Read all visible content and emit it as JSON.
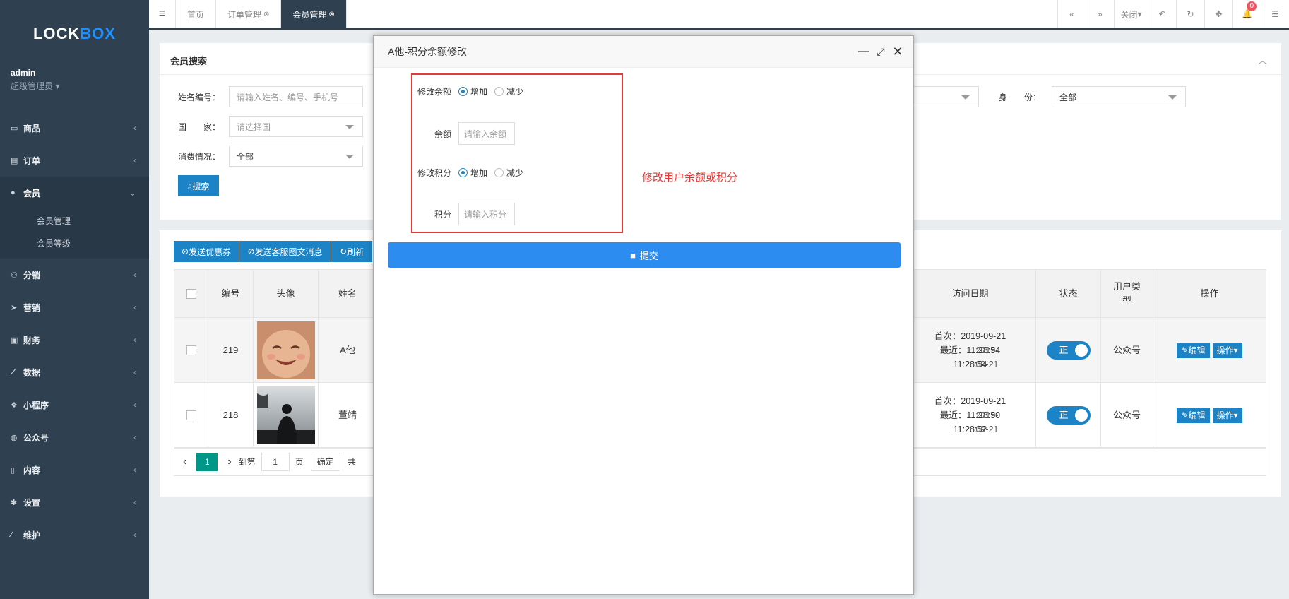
{
  "sidebar": {
    "logo": "LOCK",
    "logo_accent": "BOX",
    "user_name": "admin",
    "user_role": "超级管理员",
    "items": [
      {
        "label": "商品",
        "icon": "laptop-icon"
      },
      {
        "label": "订单",
        "icon": "file-icon"
      },
      {
        "label": "会员",
        "icon": "user-icon",
        "active": true,
        "children": [
          "会员管理",
          "会员等级"
        ]
      },
      {
        "label": "分销",
        "icon": "users-icon"
      },
      {
        "label": "营销",
        "icon": "paper-plane-icon"
      },
      {
        "label": "财务",
        "icon": "money-icon"
      },
      {
        "label": "数据",
        "icon": "line-chart-icon"
      },
      {
        "label": "小程序",
        "icon": "cubes-icon"
      },
      {
        "label": "公众号",
        "icon": "wechat-icon"
      },
      {
        "label": "内容",
        "icon": "book-icon"
      },
      {
        "label": "设置",
        "icon": "gear-icon"
      },
      {
        "label": "维护",
        "icon": "wand-icon"
      }
    ]
  },
  "topbar": {
    "tabs": [
      {
        "label": "首页"
      },
      {
        "label": "订单管理"
      },
      {
        "label": "会员管理",
        "active": true
      }
    ],
    "close_label": "关闭",
    "notif_count": "0"
  },
  "search": {
    "title": "会员搜索",
    "name_label": "姓名编号：",
    "name_placeholder": "请输入姓名、编号、手机号",
    "country_label": "国　　家：",
    "country_value": "请选择国",
    "consume_label": "消费情况：",
    "consume_value": "全部",
    "identity_label": "身　　份：",
    "identity_value": "全部",
    "search_btn": "搜索"
  },
  "toolbar": {
    "coupon_btn": "发送优惠券",
    "message_btn": "发送客服图文消息",
    "refresh_btn": "刷新"
  },
  "table": {
    "headers": {
      "id": "编号",
      "avatar": "头像",
      "name": "姓名",
      "visit": "访问日期",
      "status": "状态",
      "user_type": "用户类型",
      "ops": "操作"
    },
    "rows": [
      {
        "id": "219",
        "name": "A他",
        "visit_first": "首次：2019-09-21",
        "visit_last_a": "最近：",
        "visit_last_b": "11:28:54",
        "visit_overlay": "2019-09-21",
        "time": "11:28:54",
        "status": "正",
        "user_type": "公众号"
      },
      {
        "id": "218",
        "name": "董靖",
        "visit_first": "首次：2019-09-21",
        "visit_last_a": "最近：",
        "visit_last_b": "11:28:50",
        "visit_overlay": "2019-09-21",
        "time": "11:28:52",
        "status": "正",
        "user_type": "公众号"
      }
    ],
    "edit_btn": "编辑",
    "action_btn": "操作"
  },
  "pager": {
    "current": "1",
    "goto_label": "到第",
    "page_input": "1",
    "page_unit": "页",
    "confirm": "确定",
    "total_prefix": "共"
  },
  "modal": {
    "title": "A他-积分余额修改",
    "balance_mode_label": "修改余额",
    "increase": "增加",
    "decrease": "减少",
    "balance_label": "余额",
    "balance_placeholder": "请输入余额",
    "points_mode_label": "修改积分",
    "points_label": "积分",
    "points_placeholder": "请输入积分",
    "note": "修改用户余额或积分",
    "submit": "提交"
  },
  "colors": {
    "sidebar": "#2f4050",
    "primary": "#1c84c6",
    "submit": "#2d8cf0",
    "annotation": "#e53935"
  }
}
